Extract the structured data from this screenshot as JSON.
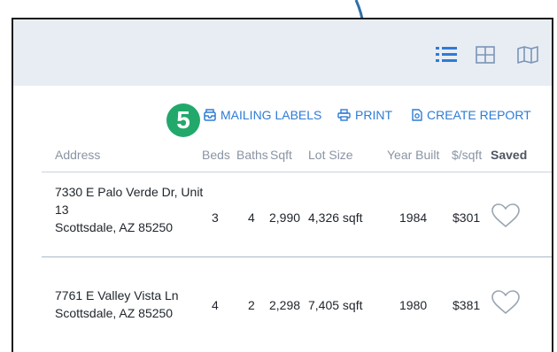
{
  "colors": {
    "accent": "#2e7bd6",
    "badge": "#22a86b",
    "topbar": "#e8edf4"
  },
  "view_toggle": {
    "icons": [
      "list-view-icon",
      "grid-view-icon",
      "map-view-icon"
    ],
    "active": "list-view-icon"
  },
  "step_badge": "5",
  "actions": {
    "mailing_labels": "MAILING LABELS",
    "print": "PRINT",
    "create_report": "CREATE REPORT"
  },
  "table": {
    "headers": {
      "address": "Address",
      "beds": "Beds",
      "baths": "Baths",
      "sqft": "Sqft",
      "lot_size": "Lot Size",
      "year_built": "Year Built",
      "price_sqft": "$/sqft",
      "saved": "Saved"
    },
    "rows": [
      {
        "address_line1": "7330 E Palo Verde Dr, Unit",
        "address_line2": "13",
        "address_line3": "Scottsdale, AZ 85250",
        "beds": "3",
        "baths": "4",
        "sqft": "2,990",
        "lot_size": "4,326 sqft",
        "year_built": "1984",
        "price_sqft": "$301"
      },
      {
        "address_line1": "7761 E Valley Vista Ln",
        "address_line2": "Scottsdale, AZ 85250",
        "beds": "4",
        "baths": "2",
        "sqft": "2,298",
        "lot_size": "7,405 sqft",
        "year_built": "1980",
        "price_sqft": "$381"
      }
    ]
  }
}
